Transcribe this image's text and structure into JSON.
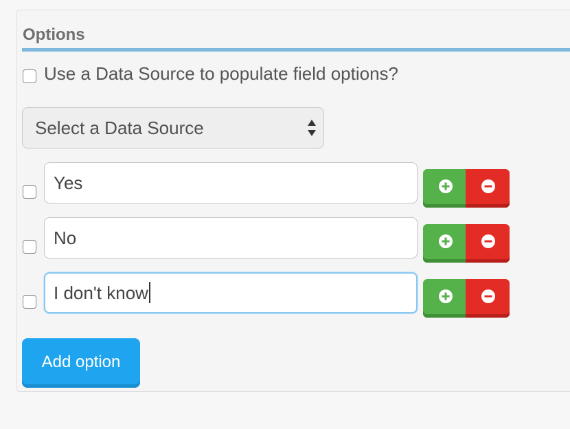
{
  "section": {
    "title": "Options"
  },
  "data_source": {
    "checkbox_label": "Use a Data Source to populate field options?",
    "checked": false,
    "select_value": "Select a Data Source"
  },
  "options": [
    {
      "value": "Yes",
      "checked": false
    },
    {
      "value": "No",
      "checked": false
    },
    {
      "value": "I don't know",
      "checked": false,
      "focused": true
    }
  ],
  "controls": {
    "add_icon": "plus-circle-icon",
    "remove_icon": "minus-circle-icon",
    "add_option_label": "Add option"
  },
  "colors": {
    "accent_rule": "#7fb8dd",
    "add_button": "#55b24a",
    "remove_button": "#e42c27",
    "primary_button": "#1fa4ef"
  }
}
